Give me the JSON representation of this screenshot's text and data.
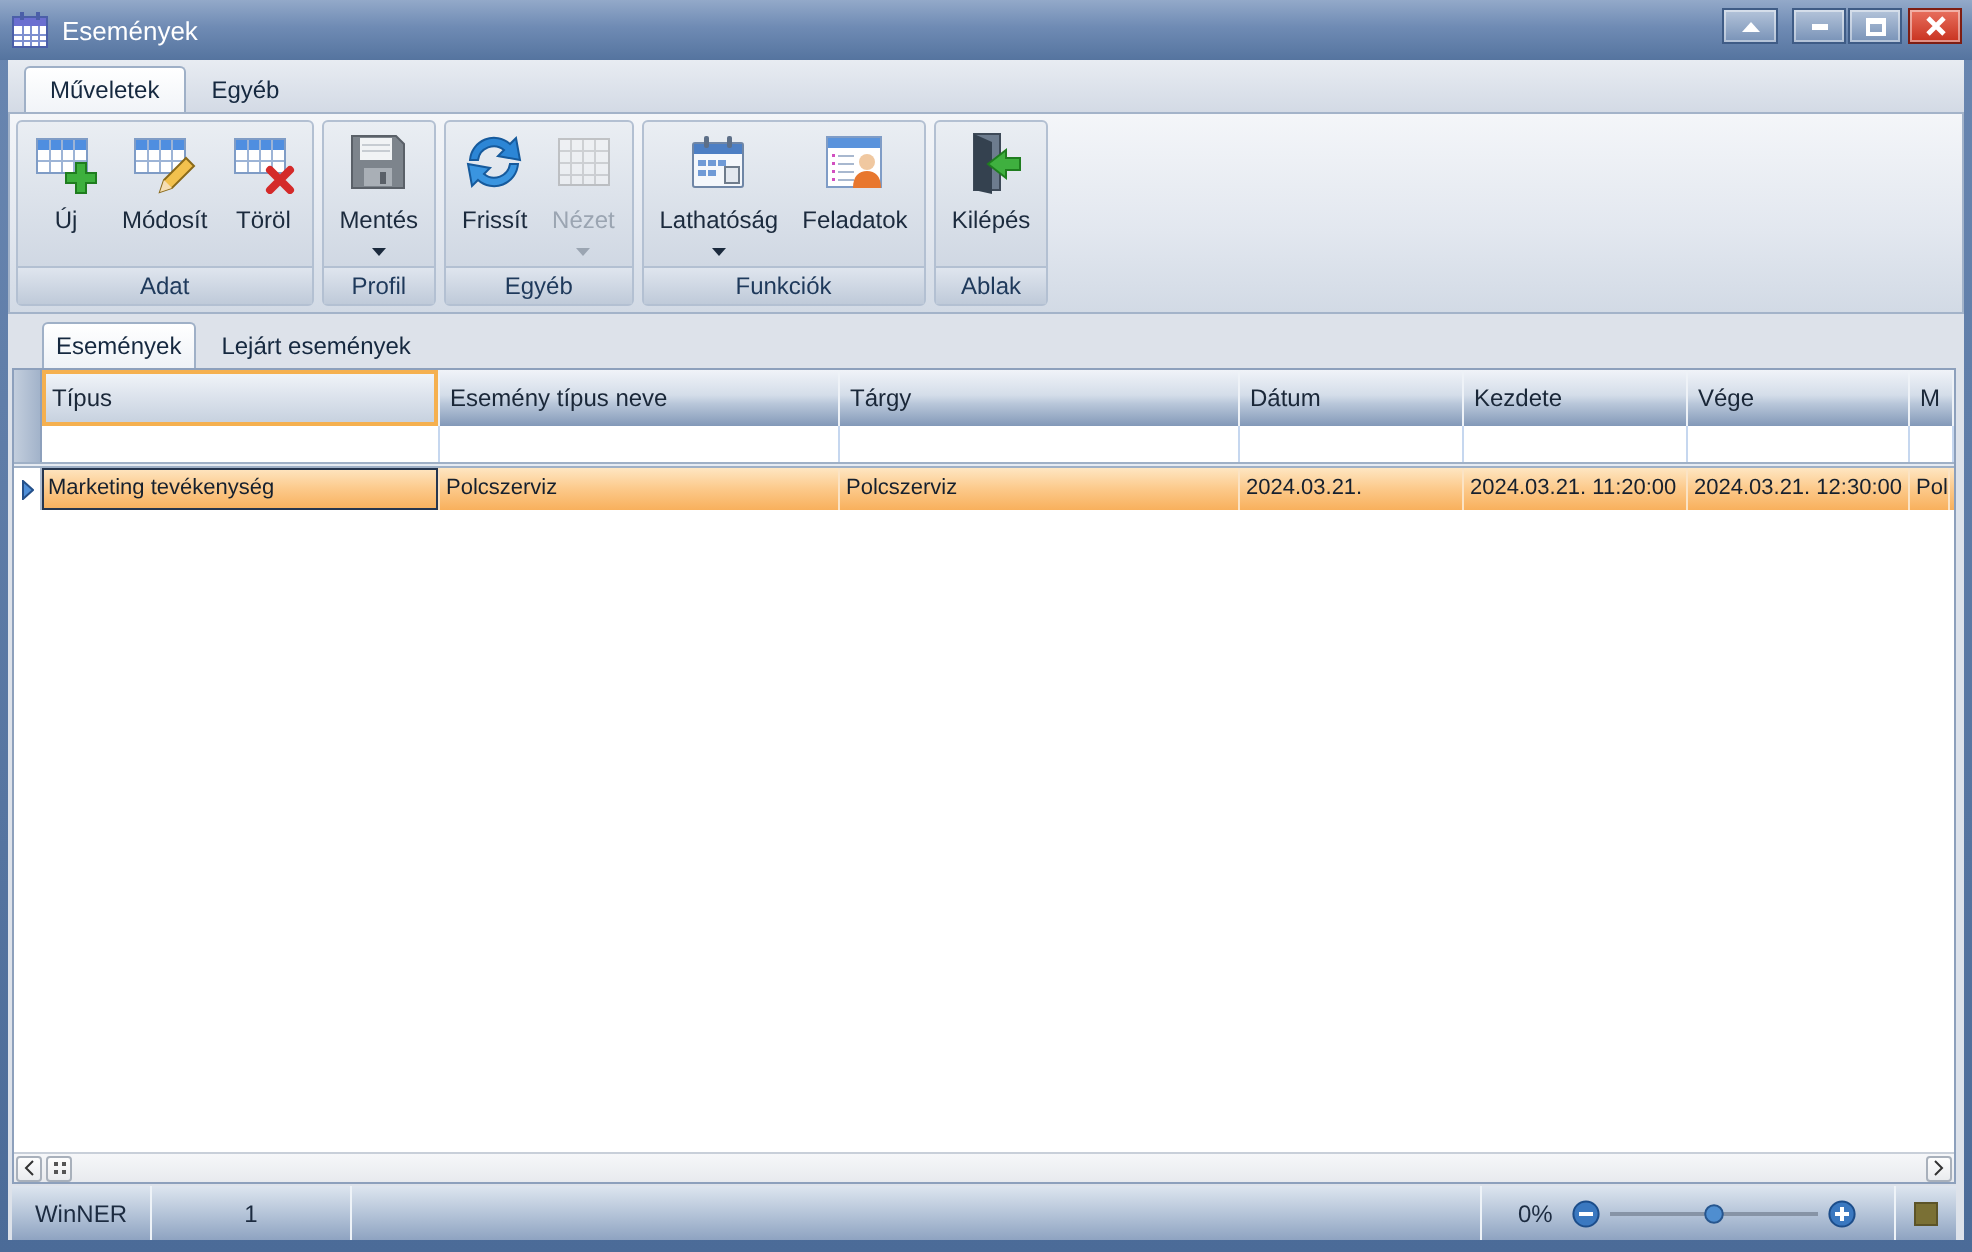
{
  "window": {
    "title": "Események"
  },
  "ribbon": {
    "tabs": [
      {
        "label": "Műveletek",
        "selected": true
      },
      {
        "label": "Egyéb",
        "selected": false
      }
    ],
    "groups": [
      {
        "label": "Adat",
        "buttons": [
          {
            "kind": "new",
            "label": "Új",
            "dropdown": false,
            "disabled": false
          },
          {
            "kind": "edit",
            "label": "Módosít",
            "dropdown": false,
            "disabled": false
          },
          {
            "kind": "delete",
            "label": "Töröl",
            "dropdown": false,
            "disabled": false
          }
        ]
      },
      {
        "label": "Profil",
        "buttons": [
          {
            "kind": "save",
            "label": "Mentés",
            "dropdown": true,
            "disabled": false
          }
        ]
      },
      {
        "label": "Egyéb",
        "buttons": [
          {
            "kind": "refresh",
            "label": "Frissít",
            "dropdown": false,
            "disabled": false
          },
          {
            "kind": "view",
            "label": "Nézet",
            "dropdown": true,
            "disabled": true
          }
        ]
      },
      {
        "label": "Funkciók",
        "buttons": [
          {
            "kind": "calendar",
            "label": "Lathatóság",
            "dropdown": true,
            "disabled": false
          },
          {
            "kind": "tasks",
            "label": "Feladatok",
            "dropdown": false,
            "disabled": false
          }
        ]
      },
      {
        "label": "Ablak",
        "buttons": [
          {
            "kind": "exit",
            "label": "Kilépés",
            "dropdown": false,
            "disabled": false
          }
        ]
      }
    ]
  },
  "document_tabs": [
    {
      "label": "Események",
      "selected": true
    },
    {
      "label": "Lejárt események",
      "selected": false
    }
  ],
  "table": {
    "columns": [
      {
        "label": "Típus",
        "selected": true
      },
      {
        "label": "Esemény típus neve",
        "selected": false
      },
      {
        "label": "Tárgy",
        "selected": false
      },
      {
        "label": "Dátum",
        "selected": false
      },
      {
        "label": "Kezdete",
        "selected": false
      },
      {
        "label": "Vége",
        "selected": false
      },
      {
        "label": "M",
        "selected": false
      }
    ],
    "rows": [
      {
        "selected": true,
        "cells": [
          {
            "text": "Marketing tevékenység",
            "focused": true
          },
          {
            "text": "Polcszerviz",
            "focused": false
          },
          {
            "text": "Polcszerviz",
            "focused": false
          },
          {
            "text": "2024.03.21.",
            "focused": false
          },
          {
            "text": "2024.03.21. 11:20:00",
            "focused": false
          },
          {
            "text": "2024.03.21. 12:30:00",
            "focused": false
          },
          {
            "text": "Pol",
            "focused": false
          }
        ]
      }
    ]
  },
  "status_bar": {
    "items": [
      "WinNER",
      "1"
    ],
    "zoom": {
      "reading": "0%",
      "level": 0.5
    }
  }
}
